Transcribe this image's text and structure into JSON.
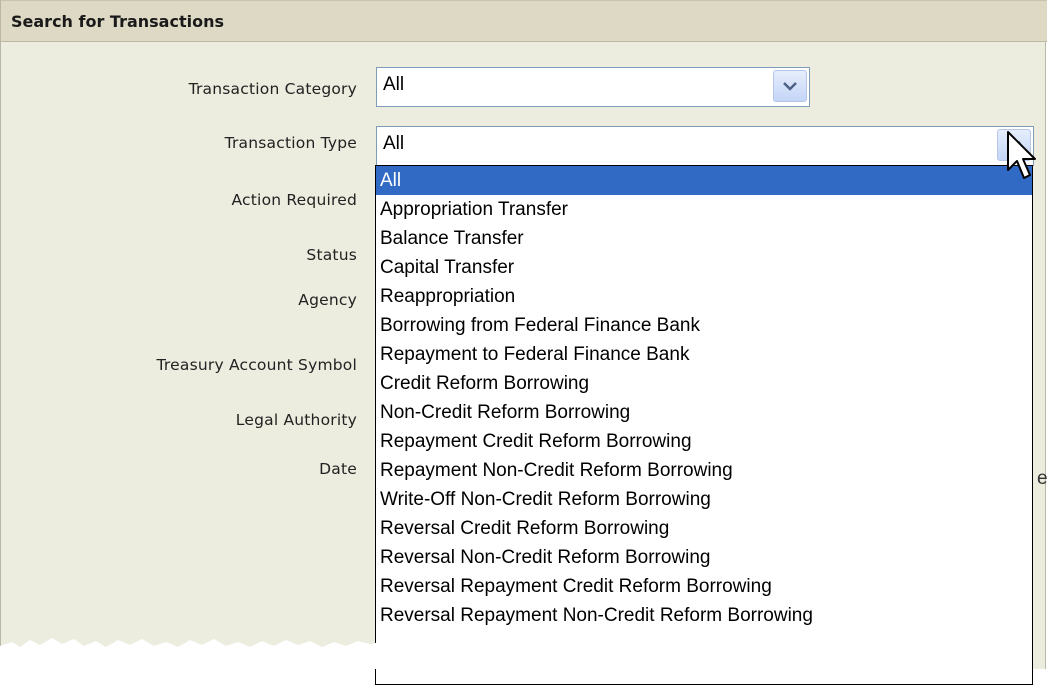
{
  "panel": {
    "title": "Search for Transactions"
  },
  "fields": {
    "transaction_category": {
      "label": "Transaction Category",
      "value": "All"
    },
    "transaction_type": {
      "label": "Transaction Type",
      "value": "All"
    },
    "action_required": {
      "label": "Action Required"
    },
    "status": {
      "label": "Status"
    },
    "agency": {
      "label": "Agency"
    },
    "treasury_account_symbol": {
      "label": "Treasury Account Symbol"
    },
    "legal_authority": {
      "label": "Legal Authority"
    },
    "date": {
      "label": "Date"
    }
  },
  "dropdown": {
    "selected_index": 0,
    "options": [
      "All",
      "Appropriation Transfer",
      "Balance Transfer",
      "Capital Transfer",
      "Reappropriation",
      "Borrowing from Federal Finance Bank",
      "Repayment to Federal Finance Bank",
      "Credit Reform Borrowing",
      "Non-Credit Reform Borrowing",
      "Repayment Credit Reform Borrowing",
      "Repayment Non-Credit Reform Borrowing",
      "Write-Off Non-Credit Reform Borrowing",
      "Reversal Credit Reform Borrowing",
      "Reversal Non-Credit Reform Borrowing",
      "Reversal Repayment Credit Reform Borrowing",
      "Reversal Repayment Non-Credit Reform Borrowing"
    ]
  },
  "stray_text": "e",
  "icons": {
    "dropdown_arrow": "chevron-down-icon",
    "pointer": "cursor-arrow-icon"
  },
  "colors": {
    "selection": "#316ac5",
    "header_bg": "#ddd9c5",
    "panel_bg": "#ececdf",
    "select_border": "#7f9db9"
  }
}
